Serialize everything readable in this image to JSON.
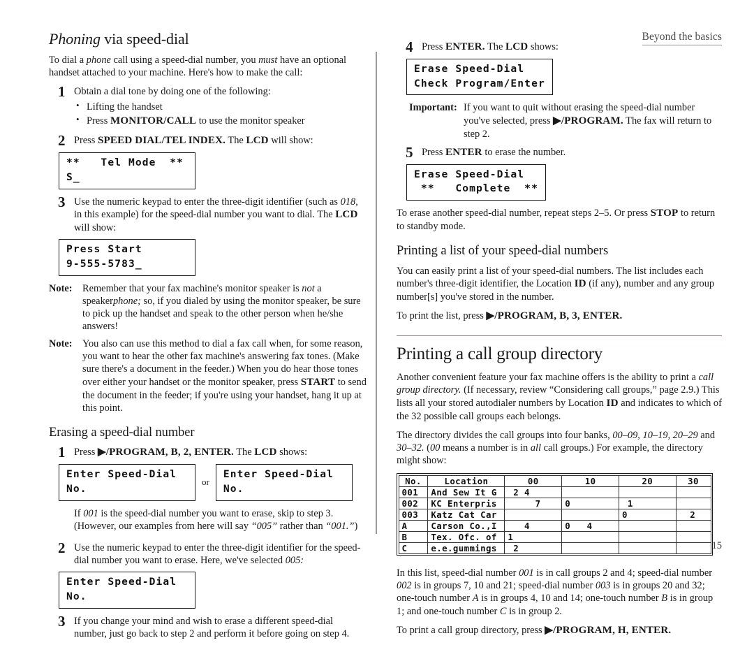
{
  "running_head": "Beyond the basics",
  "page_number": "2.15",
  "left_column": {
    "heading_italic": "Phoning",
    "heading_rest": " via speed-dial",
    "intro": "To dial a ",
    "intro_it1": "phone",
    "intro_mid": " call using a speed-dial number, you ",
    "intro_it2": "must",
    "intro_end": " have an optional handset attached to your machine. Here's how to make the call:",
    "step1": {
      "num": "1",
      "text": "Obtain a dial tone by doing one of the following:",
      "bullets": [
        {
          "pre": "Lifting the handset",
          "key": "",
          "post": ""
        },
        {
          "pre": "Press ",
          "key": "MONITOR/CALL",
          "post": " to use the monitor speaker"
        }
      ]
    },
    "step2": {
      "num": "2",
      "pre": "Press ",
      "key": "SPEED DIAL/TEL INDEX.",
      "post": " The ",
      "lcd_word": "LCD",
      "post2": " will show:",
      "lcd_line1": "**   Tel Mode  **",
      "lcd_line2": "S_"
    },
    "step3": {
      "num": "3",
      "pre": "Use the numeric keypad to enter the three-digit identifier (such as ",
      "it": "018",
      "post": ", in this example) for the speed-dial number you want to dial. The ",
      "lcd_word": "LCD",
      "post2": " will show:",
      "lcd_line1": "Press Start",
      "lcd_line2": "9-555-5783_"
    },
    "note1": {
      "label": "Note:",
      "p1": "Remember that your fax machine's monitor speaker is ",
      "it1": "not",
      "p2": " a speaker",
      "it2": "phone;",
      "p3": " so, if you dialed by using the monitor speaker, be sure to pick up the handset and speak to the other person when he/she answers!"
    },
    "note2": {
      "label": "Note:",
      "p1": "You also can use this method to dial a fax call when, for some reason, you want to hear the other fax machine's answering fax tones. (Make sure there's a document in the feeder.) When you do hear those tones over either your handset or the monitor speaker, press ",
      "key": "START",
      "p2": " to send the document in the feeder; if you're using your handset, hang it up at this point."
    },
    "erase_heading": "Erasing a speed-dial number",
    "erase_step1": {
      "num": "1",
      "pre": "Press ",
      "key": "▶/PROGRAM, B, 2, ENTER.",
      "post": " The ",
      "lcd_word": "LCD",
      "post2": " shows:",
      "lcd_a_line1": "Enter Speed-Dial",
      "lcd_a_line2": "No.",
      "or": "or",
      "lcd_b_line1": "Enter Speed-Dial",
      "lcd_b_line2": "No.",
      "after_pre": "If ",
      "after_it1": "001",
      "after_mid": " is the speed-dial number you want to erase, skip to step 3. (However, our examples from here will say ",
      "after_it2": "“005”",
      "after_mid2": " rather than ",
      "after_it3": "“001.”",
      "after_end": ")"
    },
    "erase_step2": {
      "num": "2",
      "pre": "Use the numeric keypad to enter the three-digit identifier for the speed-dial number you want to erase. Here, we've selected ",
      "it": "005:",
      "lcd_line1": "Enter Speed-Dial",
      "lcd_line2": "No."
    },
    "erase_step3": {
      "num": "3",
      "text": "If you change your mind and wish to erase a different speed-dial number, just go back to step 2 and perform it before going on step 4."
    }
  },
  "right_column": {
    "step4": {
      "num": "4",
      "pre": "Press ",
      "key": "ENTER.",
      "post": " The ",
      "lcd_word": "LCD",
      "post2": " shows:",
      "lcd_line1": "Erase Speed-Dial",
      "lcd_line2": "Check Program/Enter"
    },
    "important": {
      "label": "Important:",
      "p1": "If you want to quit without erasing the speed-dial number you've selected, press ",
      "key": "▶/PROGRAM.",
      "p2": " The fax will return to step 2."
    },
    "step5": {
      "num": "5",
      "pre": "Press ",
      "key": "ENTER",
      "post": " to erase the number.",
      "lcd_line1": "Erase Speed-Dial",
      "lcd_line2": " **   Complete  **"
    },
    "erase_again_pre": "To erase another speed-dial number, repeat steps 2–5. Or press ",
    "erase_again_key": "STOP",
    "erase_again_post": " to return to standby mode.",
    "print_list_heading": "Printing a list of your speed-dial numbers",
    "print_list_p1a": "You can easily print a list of your speed-dial numbers. The list includes each number's three-digit identifier, the Location ",
    "print_list_id": "ID",
    "print_list_p1b": " (if any), number and any group number[s] you've stored in the number.",
    "print_list_p2_pre": "To print the list, press ",
    "print_list_p2_key": "▶/PROGRAM, B, 3, ENTER.",
    "cgd_heading": "Printing a call group directory",
    "cgd_p1a": "Another convenient feature your fax machine offers is the ability to print a ",
    "cgd_it1": "call group directory.",
    "cgd_p1b": " (If necessary, review “Considering call groups,” page 2.9.) This lists all your stored autodialer numbers by Location ",
    "cgd_id": "ID",
    "cgd_p1c": " and indicates to which of the 32 possible call groups each belongs.",
    "cgd_p2a": "The directory divides the call groups into four banks, ",
    "cgd_it2": "00–09, 10–19, 20–29",
    "cgd_p2b": " and ",
    "cgd_it3": "30–32.",
    "cgd_p2c": " (",
    "cgd_it4": "00",
    "cgd_p2d": " means a number is in ",
    "cgd_it5": "all",
    "cgd_p2e": " call groups.) For example, the directory might show:",
    "cgd_p3a": "In this list, speed-dial number ",
    "cgd_it6": "001",
    "cgd_p3b": " is in call groups 2 and 4; speed-dial number ",
    "cgd_it7": "002",
    "cgd_p3c": " is in groups 7, 10 and 21; speed-dial number ",
    "cgd_it8": "003",
    "cgd_p3d": " is in groups 20 and 32; one-touch number ",
    "cgd_it9": "A",
    "cgd_p3e": " is in groups 4, 10 and 14; one-touch number ",
    "cgd_it10": "B",
    "cgd_p3f": " is in group 1; and one-touch number ",
    "cgd_it11": "C",
    "cgd_p3g": " is in group 2.",
    "cgd_p4_pre": "To print a call group directory, press ",
    "cgd_p4_key": "▶/PROGRAM, H, ENTER."
  },
  "directory_table": {
    "headers": [
      "No.",
      "Location",
      "00",
      "10",
      "20",
      "30"
    ],
    "rows": [
      {
        "no": "001",
        "loc": "And Sew It G",
        "b00": " 2 4",
        "b10": "",
        "b20": "",
        "b30": ""
      },
      {
        "no": "002",
        "loc": "KC Enterpris",
        "b00": "     7",
        "b10": "0",
        "b20": " 1",
        "b30": ""
      },
      {
        "no": "003",
        "loc": "Katz Cat Car",
        "b00": "",
        "b10": "",
        "b20": "0",
        "b30": "  2"
      },
      {
        "no": "A",
        "loc": "Carson Co.,I",
        "b00": "   4",
        "b10": "0   4",
        "b20": "",
        "b30": ""
      },
      {
        "no": "B",
        "loc": "Tex. Ofc. of",
        "b00": "1",
        "b10": "",
        "b20": "",
        "b30": ""
      },
      {
        "no": "C",
        "loc": "e.e.gummings",
        "b00": " 2",
        "b10": "",
        "b20": "",
        "b30": ""
      }
    ]
  }
}
